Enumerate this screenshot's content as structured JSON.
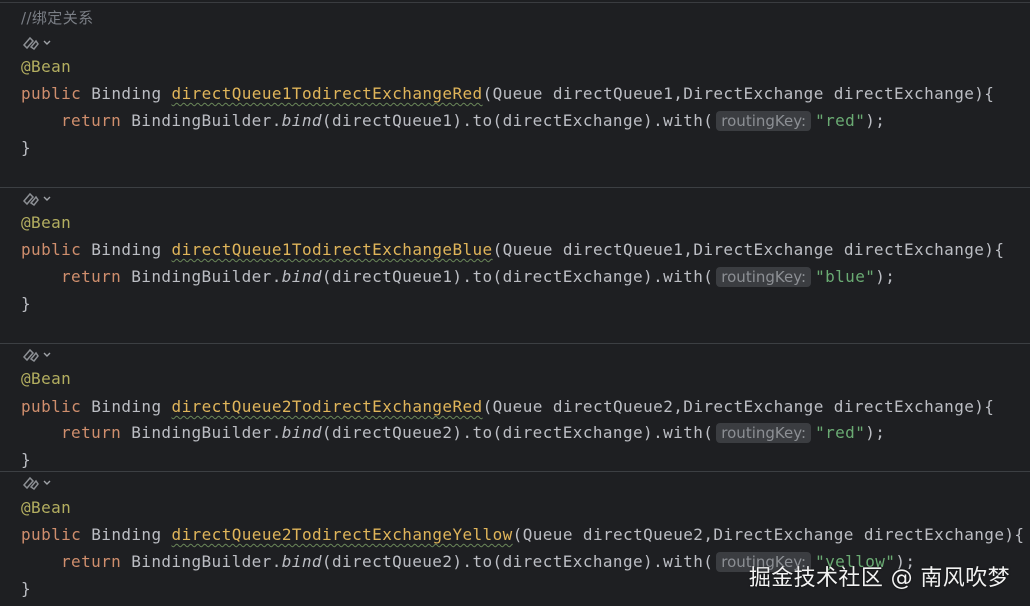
{
  "comment": "//绑定关系",
  "annotation": "@Bean",
  "keywords": {
    "public": "public",
    "return": "return"
  },
  "types": {
    "binding": "Binding",
    "queue": "Queue",
    "direct_exchange": "DirectExchange",
    "builder": "BindingBuilder"
  },
  "calls": {
    "bind": "bind",
    "to": "to",
    "with": "with",
    "exchange_arg": "directExchange"
  },
  "hint_label": "routingKey:",
  "blocks": [
    {
      "method": "directQueue1TodirectExchangeRed",
      "queue_param": "directQueue1",
      "exchange_param": "directExchange",
      "bind_arg": "directQueue1",
      "routing_key": "\"red\""
    },
    {
      "method": "directQueue1TodirectExchangeBlue",
      "queue_param": "directQueue1",
      "exchange_param": "directExchange",
      "bind_arg": "directQueue1",
      "routing_key": "\"blue\""
    },
    {
      "method": "directQueue2TodirectExchangeRed",
      "queue_param": "directQueue2",
      "exchange_param": "directExchange",
      "bind_arg": "directQueue2",
      "routing_key": "\"red\""
    },
    {
      "method": "directQueue2TodirectExchangeYellow",
      "queue_param": "directQueue2",
      "exchange_param": "directExchange",
      "bind_arg": "directQueue2",
      "routing_key": "\"yellow\""
    }
  ],
  "watermark": "掘金技术社区 @ 南风吹梦",
  "colors": {
    "background": "#1e1f22",
    "keyword": "#cf8e6d",
    "annotation": "#b3ae60",
    "method_decl": "#e0b55a",
    "string": "#6aab73",
    "text": "#bcbec4"
  }
}
